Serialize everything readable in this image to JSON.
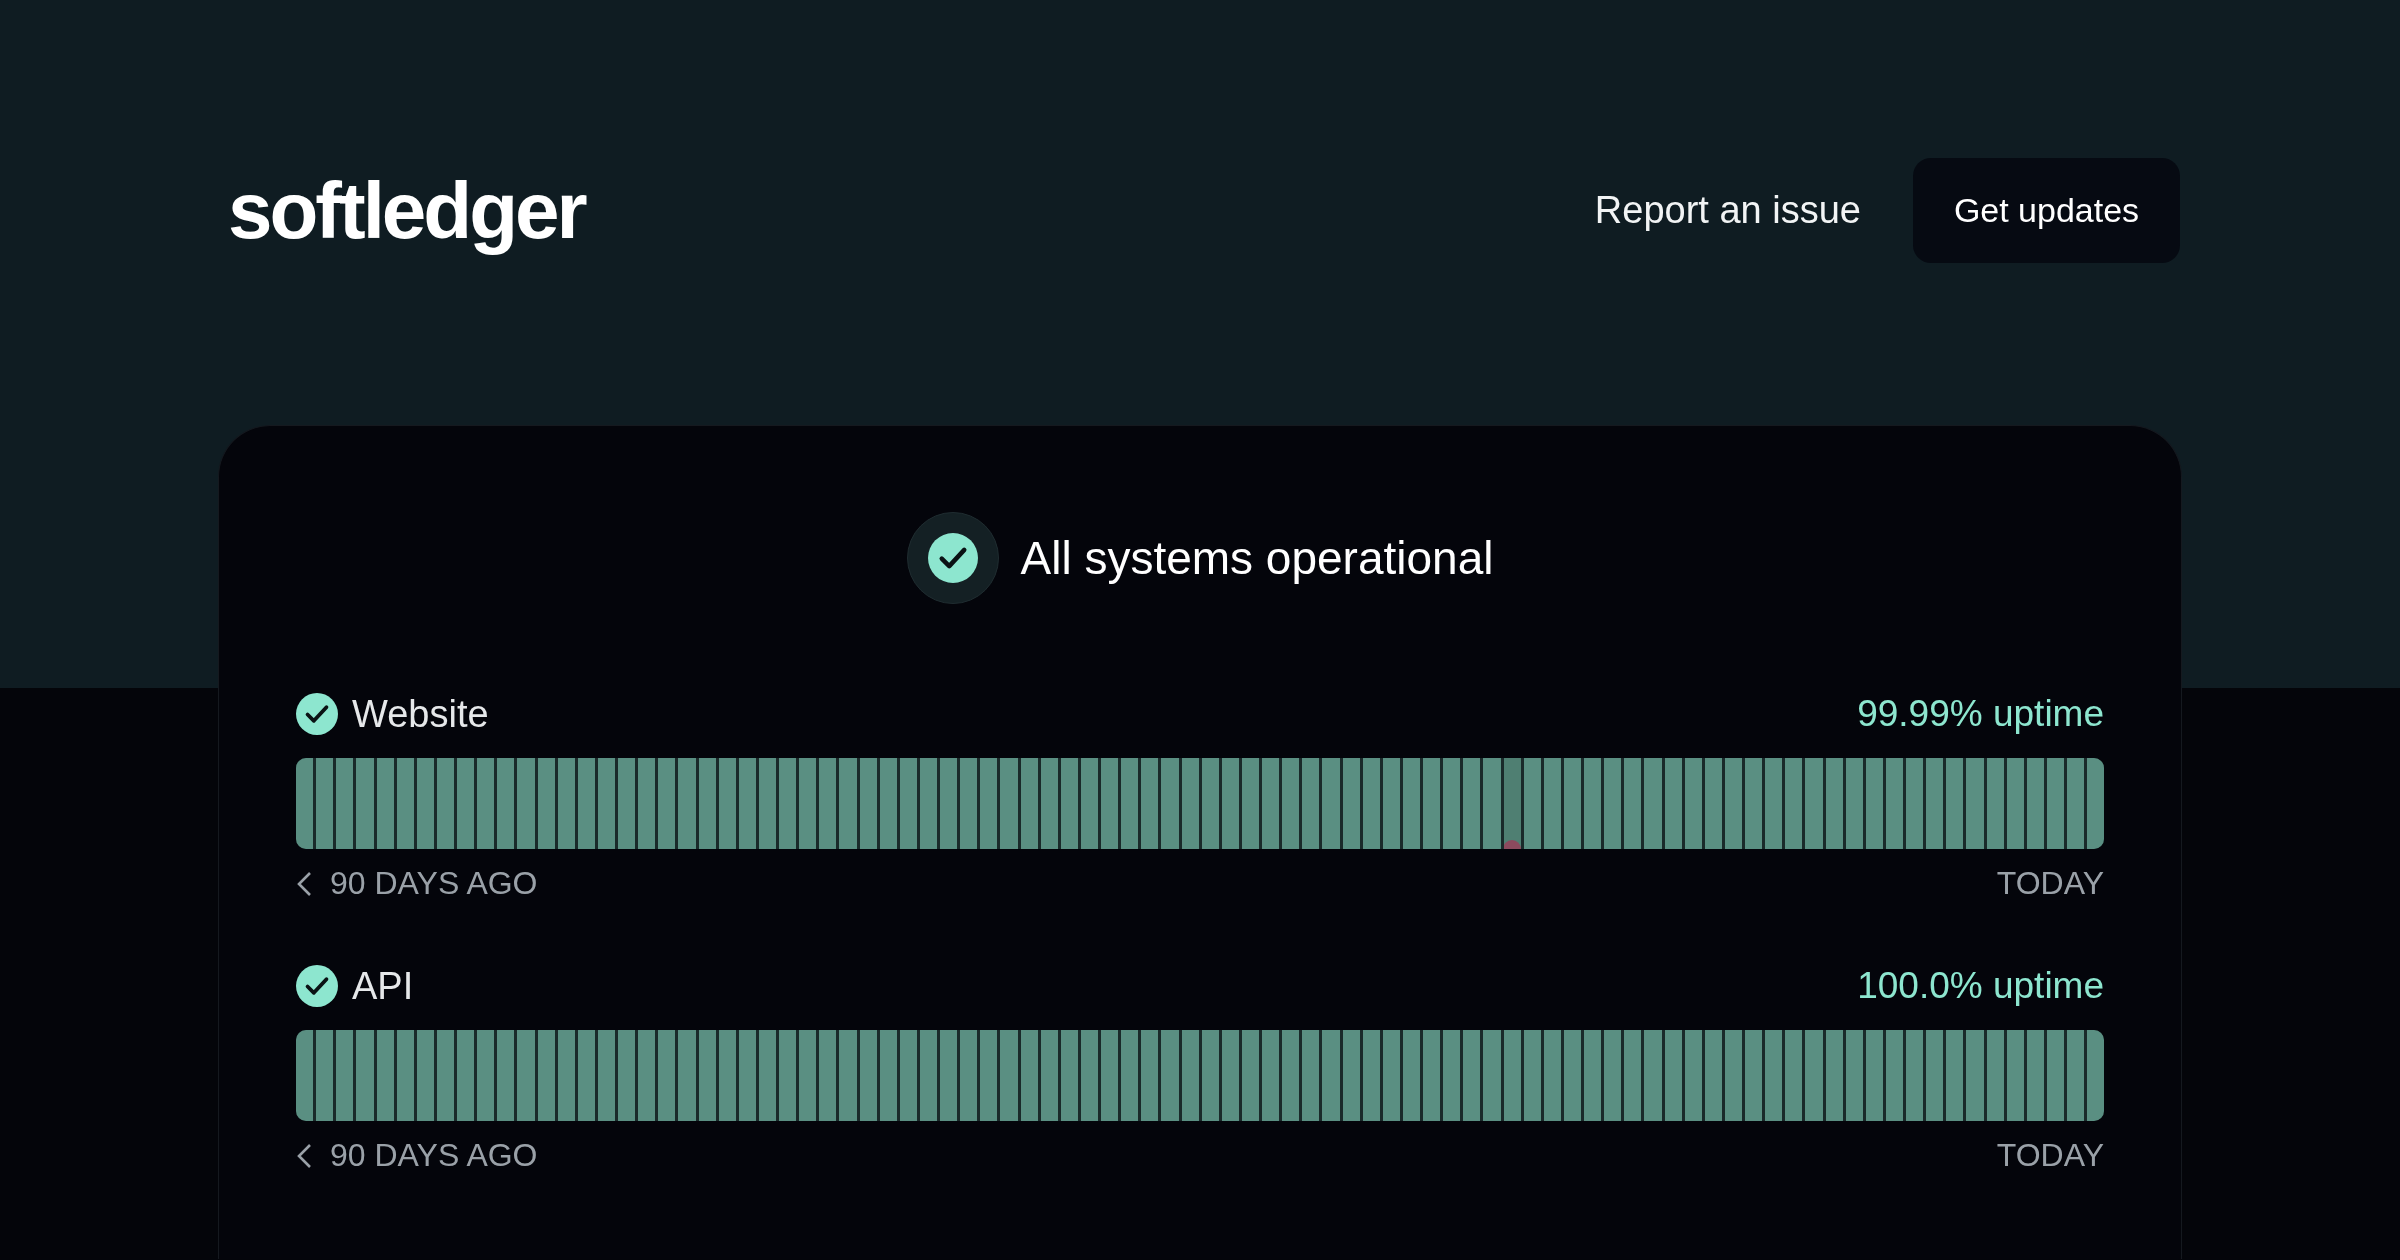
{
  "header": {
    "logo": "softledger",
    "report_link": "Report an issue",
    "updates_button": "Get updates"
  },
  "overall_status": {
    "text": "All systems operational",
    "operational": true
  },
  "services": [
    {
      "name": "Website",
      "operational": true,
      "uptime": "99.99% uptime",
      "start_label": "90 DAYS AGO",
      "end_label": "TODAY",
      "days": [
        {
          "incident": false
        },
        {
          "incident": false
        },
        {
          "incident": false
        },
        {
          "incident": false
        },
        {
          "incident": false
        },
        {
          "incident": false
        },
        {
          "incident": false
        },
        {
          "incident": false
        },
        {
          "incident": false
        },
        {
          "incident": false
        },
        {
          "incident": false
        },
        {
          "incident": false
        },
        {
          "incident": false
        },
        {
          "incident": false
        },
        {
          "incident": false
        },
        {
          "incident": false
        },
        {
          "incident": false
        },
        {
          "incident": false
        },
        {
          "incident": false
        },
        {
          "incident": false
        },
        {
          "incident": false
        },
        {
          "incident": false
        },
        {
          "incident": false
        },
        {
          "incident": false
        },
        {
          "incident": false
        },
        {
          "incident": false
        },
        {
          "incident": false
        },
        {
          "incident": false
        },
        {
          "incident": false
        },
        {
          "incident": false
        },
        {
          "incident": false
        },
        {
          "incident": false
        },
        {
          "incident": false
        },
        {
          "incident": false
        },
        {
          "incident": false
        },
        {
          "incident": false
        },
        {
          "incident": false
        },
        {
          "incident": false
        },
        {
          "incident": false
        },
        {
          "incident": false
        },
        {
          "incident": false
        },
        {
          "incident": false
        },
        {
          "incident": false
        },
        {
          "incident": false
        },
        {
          "incident": false
        },
        {
          "incident": false
        },
        {
          "incident": false
        },
        {
          "incident": false
        },
        {
          "incident": false
        },
        {
          "incident": false
        },
        {
          "incident": false
        },
        {
          "incident": false
        },
        {
          "incident": false
        },
        {
          "incident": false
        },
        {
          "incident": false
        },
        {
          "incident": false
        },
        {
          "incident": false
        },
        {
          "incident": false
        },
        {
          "incident": false
        },
        {
          "incident": false
        },
        {
          "incident": true
        },
        {
          "incident": false
        },
        {
          "incident": false
        },
        {
          "incident": false
        },
        {
          "incident": false
        },
        {
          "incident": false
        },
        {
          "incident": false
        },
        {
          "incident": false
        },
        {
          "incident": false
        },
        {
          "incident": false
        },
        {
          "incident": false
        },
        {
          "incident": false
        },
        {
          "incident": false
        },
        {
          "incident": false
        },
        {
          "incident": false
        },
        {
          "incident": false
        },
        {
          "incident": false
        },
        {
          "incident": false
        },
        {
          "incident": false
        },
        {
          "incident": false
        },
        {
          "incident": false
        },
        {
          "incident": false
        },
        {
          "incident": false
        },
        {
          "incident": false
        },
        {
          "incident": false
        },
        {
          "incident": false
        },
        {
          "incident": false
        },
        {
          "incident": false
        },
        {
          "incident": false
        },
        {
          "incident": false
        }
      ]
    },
    {
      "name": "API",
      "operational": true,
      "uptime": "100.0% uptime",
      "start_label": "90 DAYS AGO",
      "end_label": "TODAY",
      "days": [
        {
          "incident": false
        },
        {
          "incident": false
        },
        {
          "incident": false
        },
        {
          "incident": false
        },
        {
          "incident": false
        },
        {
          "incident": false
        },
        {
          "incident": false
        },
        {
          "incident": false
        },
        {
          "incident": false
        },
        {
          "incident": false
        },
        {
          "incident": false
        },
        {
          "incident": false
        },
        {
          "incident": false
        },
        {
          "incident": false
        },
        {
          "incident": false
        },
        {
          "incident": false
        },
        {
          "incident": false
        },
        {
          "incident": false
        },
        {
          "incident": false
        },
        {
          "incident": false
        },
        {
          "incident": false
        },
        {
          "incident": false
        },
        {
          "incident": false
        },
        {
          "incident": false
        },
        {
          "incident": false
        },
        {
          "incident": false
        },
        {
          "incident": false
        },
        {
          "incident": false
        },
        {
          "incident": false
        },
        {
          "incident": false
        },
        {
          "incident": false
        },
        {
          "incident": false
        },
        {
          "incident": false
        },
        {
          "incident": false
        },
        {
          "incident": false
        },
        {
          "incident": false
        },
        {
          "incident": false
        },
        {
          "incident": false
        },
        {
          "incident": false
        },
        {
          "incident": false
        },
        {
          "incident": false
        },
        {
          "incident": false
        },
        {
          "incident": false
        },
        {
          "incident": false
        },
        {
          "incident": false
        },
        {
          "incident": false
        },
        {
          "incident": false
        },
        {
          "incident": false
        },
        {
          "incident": false
        },
        {
          "incident": false
        },
        {
          "incident": false
        },
        {
          "incident": false
        },
        {
          "incident": false
        },
        {
          "incident": false
        },
        {
          "incident": false
        },
        {
          "incident": false
        },
        {
          "incident": false
        },
        {
          "incident": false
        },
        {
          "incident": false
        },
        {
          "incident": false
        },
        {
          "incident": false
        },
        {
          "incident": false
        },
        {
          "incident": false
        },
        {
          "incident": false
        },
        {
          "incident": false
        },
        {
          "incident": false
        },
        {
          "incident": false
        },
        {
          "incident": false
        },
        {
          "incident": false
        },
        {
          "incident": false
        },
        {
          "incident": false
        },
        {
          "incident": false
        },
        {
          "incident": false
        },
        {
          "incident": false
        },
        {
          "incident": false
        },
        {
          "incident": false
        },
        {
          "incident": false
        },
        {
          "incident": false
        },
        {
          "incident": false
        },
        {
          "incident": false
        },
        {
          "incident": false
        },
        {
          "incident": false
        },
        {
          "incident": false
        },
        {
          "incident": false
        },
        {
          "incident": false
        },
        {
          "incident": false
        },
        {
          "incident": false
        },
        {
          "incident": false
        },
        {
          "incident": false
        },
        {
          "incident": false
        }
      ]
    }
  ]
}
